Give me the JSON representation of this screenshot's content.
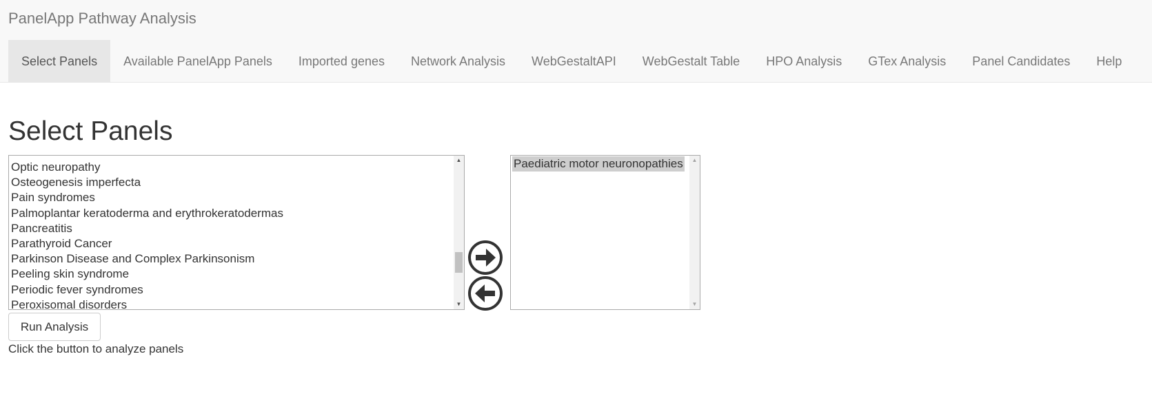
{
  "app": {
    "title": "PanelApp Pathway Analysis"
  },
  "nav": {
    "tabs": [
      {
        "label": "Select Panels",
        "active": true
      },
      {
        "label": "Available PanelApp Panels"
      },
      {
        "label": "Imported genes"
      },
      {
        "label": "Network Analysis"
      },
      {
        "label": "WebGestaltAPI"
      },
      {
        "label": "WebGestalt Table"
      },
      {
        "label": "HPO Analysis"
      },
      {
        "label": "GTex Analysis"
      },
      {
        "label": "Panel Candidates"
      },
      {
        "label": "Help"
      }
    ]
  },
  "main": {
    "title": "Select Panels",
    "available_panels": [
      "Optic neuropathy",
      "Osteogenesis imperfecta",
      "Pain syndromes",
      "Palmoplantar keratoderma and erythrokeratodermas",
      "Pancreatitis",
      "Parathyroid Cancer",
      "Parkinson Disease and Complex Parkinsonism",
      "Peeling skin syndrome",
      "Periodic fever syndromes",
      "Peroxisomal disorders"
    ],
    "selected_panels": [
      "Paediatric motor neuronopathies"
    ],
    "add_icon": "arrow-right-circle-icon",
    "remove_icon": "arrow-left-circle-icon",
    "run_button_label": "Run Analysis",
    "hint_text": "Click the button to analyze panels"
  },
  "colors": {
    "navbar_bg": "#f8f8f8",
    "active_tab_bg": "#e7e7e7",
    "nav_text": "#777777",
    "icon": "#333333",
    "selected_option_bg": "#cecece"
  }
}
